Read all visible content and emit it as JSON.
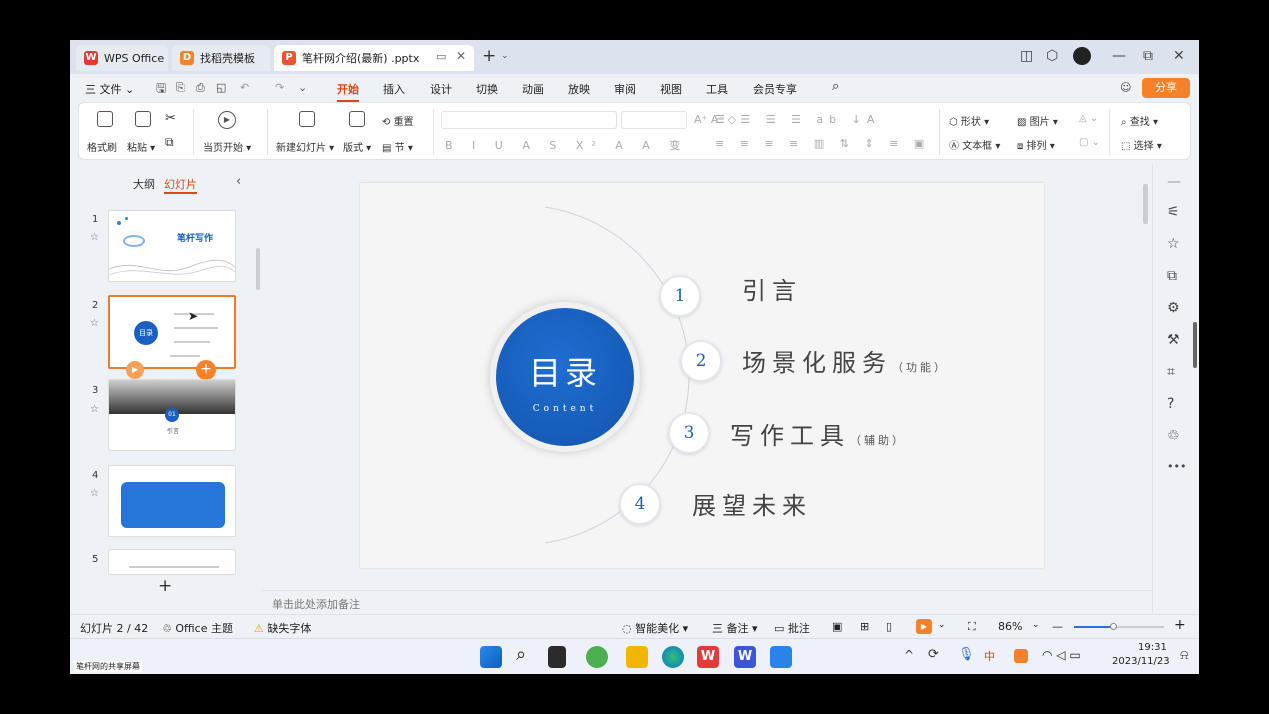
{
  "tabs": {
    "wps": "WPS Office",
    "template": "找稻壳模板",
    "doc": "笔杆网介绍(最新) .pptx"
  },
  "menu": {
    "file": "三 文件 ⌄",
    "items": [
      "开始",
      "插入",
      "设计",
      "切换",
      "动画",
      "放映",
      "审阅",
      "视图",
      "工具",
      "会员专享"
    ],
    "share": "分享"
  },
  "ribbon": {
    "format_painter": "格式刷",
    "paste": "粘贴 ▾",
    "play": "当页开始 ▾",
    "new_slide": "新建幻灯片 ▾",
    "layout": "版式 ▾",
    "reset": "重置",
    "section": "节 ▾",
    "shape": "形状 ▾",
    "picture": "图片 ▾",
    "textbox": "文本框 ▾",
    "arrange": "排列 ▾",
    "find": "查找 ▾",
    "select": "选择 ▾"
  },
  "panel": {
    "outline": "大纲",
    "slides": "幻灯片",
    "thumb1_title": "笔杆写作",
    "thumb2_title": "目录",
    "thumb3_num": "01",
    "thumb3_label": "引言"
  },
  "slide": {
    "title": "目录",
    "subtitle": "Content",
    "items": [
      {
        "num": "1",
        "label": "引言",
        "sub": ""
      },
      {
        "num": "2",
        "label": "场景化服务",
        "sub": "（功能）"
      },
      {
        "num": "3",
        "label": "写作工具",
        "sub": "（辅助）"
      },
      {
        "num": "4",
        "label": "展望未来",
        "sub": ""
      }
    ]
  },
  "notes_placeholder": "单击此处添加备注",
  "status": {
    "slide_count": "幻灯片 2 / 42",
    "theme": "Office 主题",
    "missing_font": "缺失字体",
    "beautify": "智能美化 ▾",
    "notes": "三 备注 ▾",
    "comment": "批注",
    "zoom": "86%"
  },
  "taskbar": {
    "time": "19:31",
    "date": "2023/11/23",
    "ime": "中"
  },
  "overlay_label": "笔杆网的共享屏幕",
  "colors": {
    "accent": "#d9480f",
    "slide_blue": "#1a5fc1",
    "share": "#f5822a"
  }
}
